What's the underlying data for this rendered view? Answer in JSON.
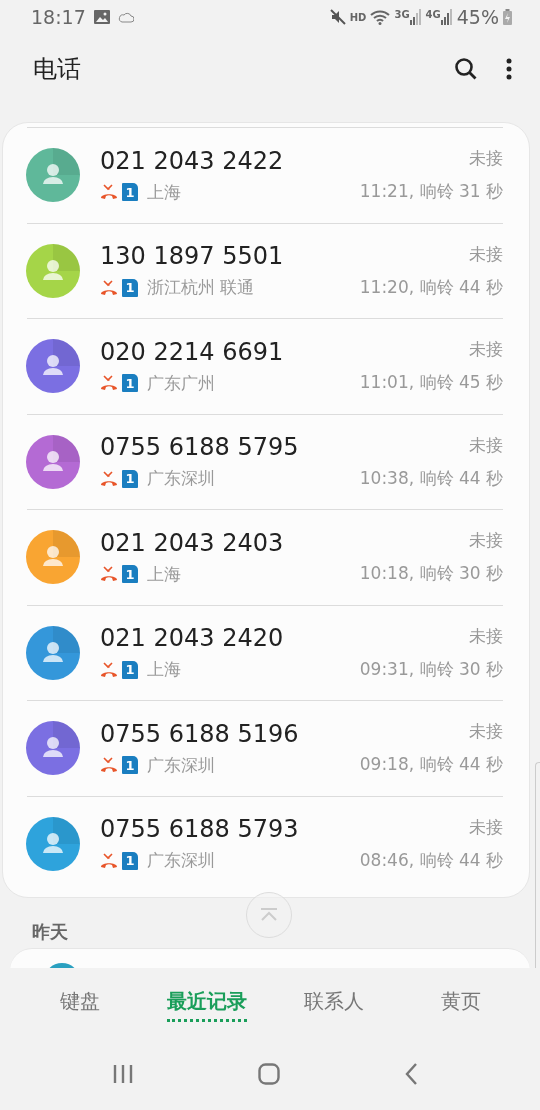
{
  "status_bar": {
    "time": "18:17",
    "hd": "HD",
    "net_1": "3G",
    "net_2": "4G",
    "battery": "45%"
  },
  "header": {
    "title": "电话"
  },
  "calls": [
    {
      "number": "021 2043 2422",
      "sim": "1",
      "location": "上海",
      "status": "未接",
      "detail": "11:21, 响铃 31 秒",
      "color": "#5fb89a"
    },
    {
      "number": "130 1897 5501",
      "sim": "1",
      "location": "浙江杭州 联通",
      "status": "未接",
      "detail": "11:20, 响铃 44 秒",
      "color": "#a5d548"
    },
    {
      "number": "020 2214 6691",
      "sim": "1",
      "location": "广东广州",
      "status": "未接",
      "detail": "11:01, 响铃 45 秒",
      "color": "#7b6fe2"
    },
    {
      "number": "0755 6188 5795",
      "sim": "1",
      "location": "广东深圳",
      "status": "未接",
      "detail": "10:38, 响铃 44 秒",
      "color": "#b46ad4"
    },
    {
      "number": "021 2043 2403",
      "sim": "1",
      "location": "上海",
      "status": "未接",
      "detail": "10:18, 响铃 30 秒",
      "color": "#f9a532"
    },
    {
      "number": "021 2043 2420",
      "sim": "1",
      "location": "上海",
      "status": "未接",
      "detail": "09:31, 响铃 30 秒",
      "color": "#3497da"
    },
    {
      "number": "0755 6188 5196",
      "sim": "1",
      "location": "广东深圳",
      "status": "未接",
      "detail": "09:18, 响铃 44 秒",
      "color": "#7b6fe2"
    },
    {
      "number": "0755 6188 5793",
      "sim": "1",
      "location": "广东深圳",
      "status": "未接",
      "detail": "08:46, 响铃 44 秒",
      "color": "#2ea3dc"
    }
  ],
  "section": {
    "title": "昨天"
  },
  "tabs": [
    {
      "label": "键盘",
      "selected": false
    },
    {
      "label": "最近记录",
      "selected": true
    },
    {
      "label": "联系人",
      "selected": false
    },
    {
      "label": "黄页",
      "selected": false
    }
  ]
}
